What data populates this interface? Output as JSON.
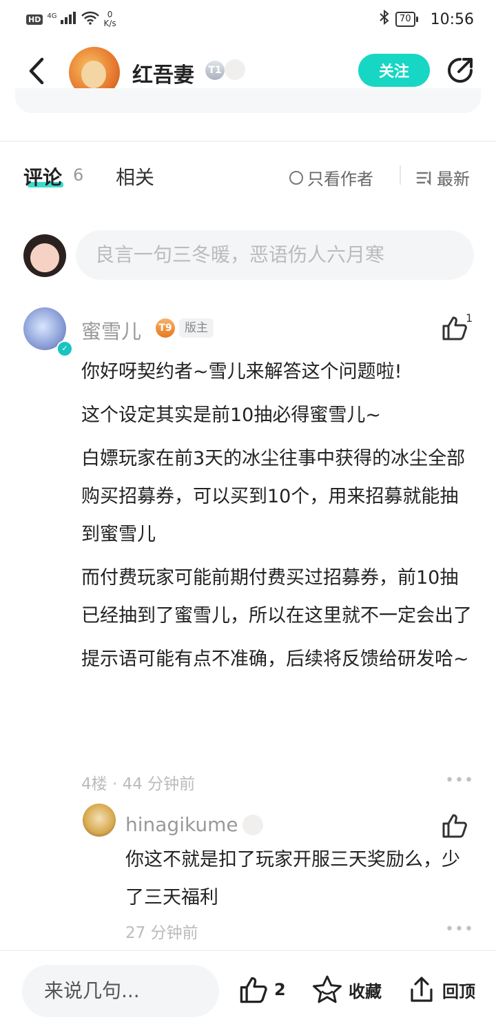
{
  "status_bar": {
    "hd_label": "HD",
    "network": "4G",
    "speed_value": "0",
    "speed_unit": "K/s",
    "battery": "70",
    "time": "10:56"
  },
  "header": {
    "author_name": "红吾妻",
    "level_badge": "T1",
    "follow_label": "关注"
  },
  "tabs": {
    "comments_label": "评论",
    "comments_count": "6",
    "related_label": "相关",
    "author_only_label": "只看作者",
    "sort_label": "最新"
  },
  "comment_input": {
    "placeholder": "良言一句三冬暖，恶语伤人六月寒"
  },
  "comment": {
    "author": "蜜雪儿",
    "level_badge": "T9",
    "role_badge": "版主",
    "likes": "1",
    "paragraphs": [
      "你好呀契约者~雪儿来解答这个问题啦!",
      "这个设定其实是前10抽必得蜜雪儿~",
      "白嫖玩家在前3天的冰尘往事中获得的冰尘全部购买招募券，可以买到10个，用来招募就能抽到蜜雪儿",
      "而付费玩家可能前期付费买过招募券，前10抽已经抽到了蜜雪儿，所以在这里就不一定会出了",
      "提示语可能有点不准确，后续将反馈给研发哈~"
    ],
    "meta": "4楼 · 44 分钟前",
    "more": "•••"
  },
  "reply": {
    "author": "hinagikume",
    "text": "你这不就是扣了玩家开服三天奖励么，少了三天福利",
    "meta": "27 分钟前",
    "more": "•••"
  },
  "bottom_bar": {
    "input_placeholder": "来说几句...",
    "like_count": "2",
    "favorite_label": "收藏",
    "top_label": "回顶"
  },
  "colors": {
    "accent": "#17d6c4"
  },
  "icons": [
    "back-arrow-icon",
    "share-icon",
    "thumbs-up-icon",
    "star-icon",
    "upload-icon",
    "sort-icon",
    "radio-icon"
  ]
}
